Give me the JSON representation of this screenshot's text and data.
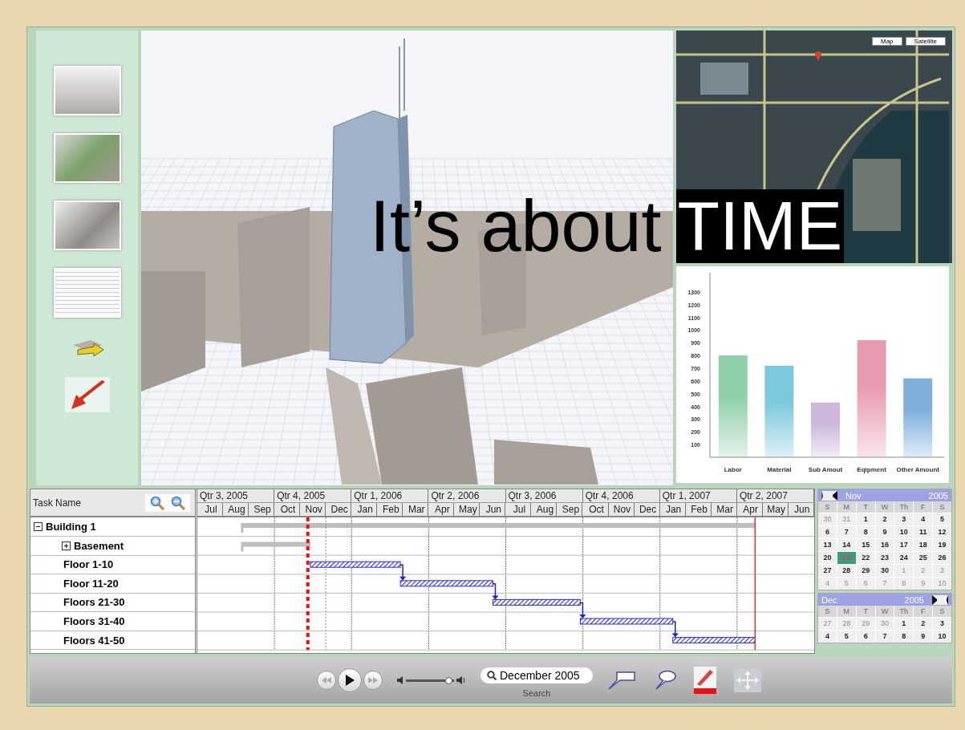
{
  "sidebar": {
    "items": [
      {
        "kind": "photo"
      },
      {
        "kind": "photo"
      },
      {
        "kind": "photo"
      },
      {
        "kind": "photo"
      },
      {
        "kind": "block-arrow"
      },
      {
        "kind": "red-arrow"
      }
    ]
  },
  "overlay": {
    "text": "It’s about",
    "highlight": "TIME"
  },
  "map": {
    "buttons": [
      "Map",
      "Satellite"
    ]
  },
  "chart": {
    "chart_data": {
      "type": "bar",
      "categories": [
        "Labor",
        "Material",
        "Sub Amout",
        "Eqipment",
        "Other Amount"
      ],
      "values": [
        800,
        720,
        430,
        920,
        620
      ],
      "ylim": [
        0,
        1450
      ],
      "yticks": [
        100,
        200,
        300,
        400,
        500,
        600,
        700,
        800,
        900,
        1000,
        1100,
        1200,
        1300
      ]
    }
  },
  "gantt": {
    "column_header": "Task Name",
    "quarters": [
      "Qtr 3, 2005",
      "Qtr 4, 2005",
      "Qtr 1, 2006",
      "Qtr 2, 2006",
      "Qtr 3, 2006",
      "Qtr 4, 2006",
      "Qtr 1, 2007",
      "Qtr 2, 2007"
    ],
    "months": [
      "Jul",
      "Aug",
      "Sep",
      "Oct",
      "Nov",
      "Dec",
      "Jan",
      "Feb",
      "Mar",
      "Apr",
      "May",
      "Jun",
      "Jul",
      "Aug",
      "Sep",
      "Oct",
      "Nov",
      "Dec",
      "Jan",
      "Feb",
      "Mar",
      "Apr",
      "May",
      "Jun"
    ],
    "tasks": [
      {
        "name": "Building 1",
        "kind": "summary",
        "expanded": true,
        "children": [
          {
            "name": "Basement",
            "kind": "summary",
            "expanded": false
          },
          {
            "name": "Floor 1-10",
            "kind": "task"
          },
          {
            "name": "Floor 11-20",
            "kind": "task"
          },
          {
            "name": "Floors 21-30",
            "kind": "task"
          },
          {
            "name": "Floors 31-40",
            "kind": "task"
          },
          {
            "name": "Floors 41-50",
            "kind": "task"
          }
        ]
      }
    ]
  },
  "calendar": {
    "months": [
      {
        "month": "Nov",
        "year": "2005",
        "prev_button": true,
        "next_button": false,
        "weekdays": [
          "S",
          "M",
          "T",
          "W",
          "Th",
          "F",
          "S"
        ],
        "days": [
          {
            "day": "30",
            "muted": true,
            "selected": false
          },
          {
            "day": "31",
            "muted": true,
            "selected": false
          },
          {
            "day": "1",
            "muted": false,
            "selected": false
          },
          {
            "day": "2",
            "muted": false,
            "selected": false
          },
          {
            "day": "3",
            "muted": false,
            "selected": false
          },
          {
            "day": "4",
            "muted": false,
            "selected": false
          },
          {
            "day": "5",
            "muted": false,
            "selected": false
          },
          {
            "day": "6",
            "muted": false,
            "selected": false
          },
          {
            "day": "7",
            "muted": false,
            "selected": false
          },
          {
            "day": "8",
            "muted": false,
            "selected": false
          },
          {
            "day": "9",
            "muted": false,
            "selected": false
          },
          {
            "day": "10",
            "muted": false,
            "selected": false
          },
          {
            "day": "11",
            "muted": false,
            "selected": false
          },
          {
            "day": "12",
            "muted": false,
            "selected": false
          },
          {
            "day": "13",
            "muted": false,
            "selected": false
          },
          {
            "day": "14",
            "muted": false,
            "selected": false
          },
          {
            "day": "15",
            "muted": false,
            "selected": false
          },
          {
            "day": "16",
            "muted": false,
            "selected": false
          },
          {
            "day": "17",
            "muted": false,
            "selected": false
          },
          {
            "day": "18",
            "muted": false,
            "selected": false
          },
          {
            "day": "19",
            "muted": false,
            "selected": false
          },
          {
            "day": "20",
            "muted": false,
            "selected": false
          },
          {
            "day": "21",
            "muted": false,
            "selected": true
          },
          {
            "day": "22",
            "muted": false,
            "selected": false
          },
          {
            "day": "23",
            "muted": false,
            "selected": false
          },
          {
            "day": "24",
            "muted": false,
            "selected": false
          },
          {
            "day": "25",
            "muted": false,
            "selected": false
          },
          {
            "day": "26",
            "muted": false,
            "selected": false
          },
          {
            "day": "27",
            "muted": false,
            "selected": false
          },
          {
            "day": "28",
            "muted": false,
            "selected": false
          },
          {
            "day": "29",
            "muted": false,
            "selected": false
          },
          {
            "day": "30",
            "muted": false,
            "selected": false
          },
          {
            "day": "1",
            "muted": true,
            "selected": false
          },
          {
            "day": "2",
            "muted": true,
            "selected": false
          },
          {
            "day": "3",
            "muted": true,
            "selected": false
          },
          {
            "day": "4",
            "muted": true,
            "selected": false
          },
          {
            "day": "5",
            "muted": true,
            "selected": false
          },
          {
            "day": "6",
            "muted": true,
            "selected": false
          },
          {
            "day": "7",
            "muted": true,
            "selected": false
          },
          {
            "day": "8",
            "muted": true,
            "selected": false
          },
          {
            "day": "9",
            "muted": true,
            "selected": false
          },
          {
            "day": "10",
            "muted": true,
            "selected": false
          }
        ]
      },
      {
        "month": "Dec",
        "year": "2005",
        "prev_button": false,
        "next_button": true,
        "weekdays": [
          "S",
          "M",
          "T",
          "W",
          "Th",
          "F",
          "S"
        ],
        "days": [
          {
            "day": "27",
            "muted": true,
            "selected": false
          },
          {
            "day": "28",
            "muted": true,
            "selected": false
          },
          {
            "day": "29",
            "muted": true,
            "selected": false
          },
          {
            "day": "30",
            "muted": true,
            "selected": false
          },
          {
            "day": "1",
            "muted": false,
            "selected": false
          },
          {
            "day": "2",
            "muted": false,
            "selected": false
          },
          {
            "day": "3",
            "muted": false,
            "selected": false
          },
          {
            "day": "4",
            "muted": false,
            "selected": false
          },
          {
            "day": "5",
            "muted": false,
            "selected": false
          },
          {
            "day": "6",
            "muted": false,
            "selected": false
          },
          {
            "day": "7",
            "muted": false,
            "selected": false
          },
          {
            "day": "8",
            "muted": false,
            "selected": false
          },
          {
            "day": "9",
            "muted": false,
            "selected": false
          },
          {
            "day": "10",
            "muted": false,
            "selected": false
          }
        ]
      }
    ]
  },
  "toolbar": {
    "volume": {
      "level": 0.88
    },
    "search": {
      "value": "December 2005",
      "label": "Search"
    },
    "tools": [
      {
        "kind": "callout-box"
      },
      {
        "kind": "callout-oval"
      },
      {
        "kind": "pen"
      },
      {
        "kind": "move"
      }
    ]
  }
}
